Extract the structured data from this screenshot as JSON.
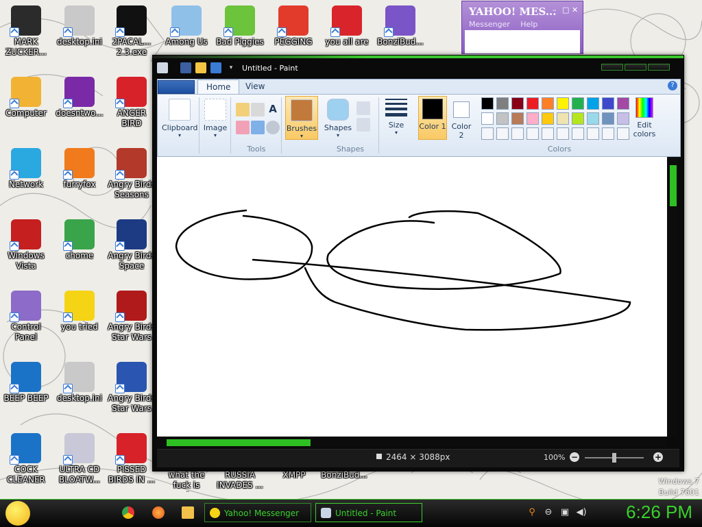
{
  "desktop_icons": [
    {
      "label": "MARK ZUCKER...",
      "color": "#2b2b2b",
      "icon": "person-icon"
    },
    {
      "label": "desktop.ini",
      "color": "#c9c9c9",
      "icon": "file-icon"
    },
    {
      "label": "2PACAL... 2.3.exe",
      "color": "#111111",
      "icon": "terminal-icon"
    },
    {
      "label": "Among Us",
      "color": "#8fc0e8",
      "icon": "among-us-icon"
    },
    {
      "label": "Bad Piggies",
      "color": "#6cc33c",
      "icon": "pig-icon"
    },
    {
      "label": "PEGGING",
      "color": "#e23b2b",
      "icon": "p-logo-icon"
    },
    {
      "label": "you all are",
      "color": "#d9242b",
      "icon": "dev-cpp-icon"
    },
    {
      "label": "BonziBud...",
      "color": "#7a55c7",
      "icon": "gorilla-icon"
    },
    {
      "label": "Computer",
      "color": "#f2b233",
      "icon": "computer-icon"
    },
    {
      "label": "doesntwo...",
      "color": "#7a2aa6",
      "icon": "yahoo-icon"
    },
    {
      "label": "ANGER BIRD",
      "color": "#d7222a",
      "icon": "angry-bird-icon"
    },
    {
      "label": "Network",
      "color": "#2aa8e0",
      "icon": "network-icon"
    },
    {
      "label": "furryfox",
      "color": "#f07a1c",
      "icon": "firefox-icon"
    },
    {
      "label": "Angry Birds Seasons",
      "color": "#b3392a",
      "icon": "angry-birds-seasons-icon"
    },
    {
      "label": "Windows Vista",
      "color": "#c51f1f",
      "icon": "recycle-bin-icon"
    },
    {
      "label": "chome",
      "color": "#3aa44a",
      "icon": "chrome-icon"
    },
    {
      "label": "Angry Birds Space",
      "color": "#1d3b83",
      "icon": "angry-birds-space-icon"
    },
    {
      "label": "Control Panel",
      "color": "#8c6bc9",
      "icon": "control-panel-icon"
    },
    {
      "label": "you tried",
      "color": "#f5d315",
      "icon": "star-icon"
    },
    {
      "label": "Angry Birds Star Wars",
      "color": "#b01a1a",
      "icon": "angry-birds-star-wars-icon"
    },
    {
      "label": "BEEP BEEP",
      "color": "#1b73c7",
      "icon": "blue-panel-icon"
    },
    {
      "label": "desktop.ini",
      "color": "#c9c9c9",
      "icon": "file-icon"
    },
    {
      "label": "Angry Birds Star Wars",
      "color": "#2a55b0",
      "icon": "angry-birds-star-wars-2-icon"
    },
    {
      "label": "COCK CLEANER",
      "color": "#1b73c7",
      "icon": "blue-panel-icon"
    },
    {
      "label": "ULTRA CD BLOATW...",
      "color": "#c8c8d8",
      "icon": "cd-icon"
    },
    {
      "label": "PISSED BIRDS IN ...",
      "color": "#d7222a",
      "icon": "angry-bird-icon"
    }
  ],
  "under_window_labels": [
    "what the fuck is goi...",
    "RUSSIA INVADES ...",
    "XMPP",
    "BonziBud..."
  ],
  "yahoo_window": {
    "title": "YAHOO! MES...",
    "menu": [
      "Messenger",
      "Help"
    ]
  },
  "paint": {
    "title": "Untitled - Paint",
    "tabs": [
      "Home",
      "View"
    ],
    "groups": {
      "clipboard": "Clipboard",
      "image": "Image",
      "tools": "Tools",
      "brushes": "Brushes",
      "shapes_btn": "Shapes",
      "shapes_group": "Shapes",
      "size": "Size",
      "color1": "Color 1",
      "color2": "Color 2",
      "colors": "Colors",
      "edit_colors": "Edit colors"
    },
    "palette_row1": [
      "#000000",
      "#7f7f7f",
      "#880015",
      "#ed1c24",
      "#ff7f27",
      "#fff200",
      "#22b14c",
      "#00a2e8",
      "#3f48cc",
      "#a349a4"
    ],
    "palette_row2": [
      "#ffffff",
      "#c3c3c3",
      "#b97a57",
      "#ffaec9",
      "#ffc90e",
      "#efe4b0",
      "#b5e61d",
      "#99d9ea",
      "#7092be",
      "#c8bfe7"
    ],
    "status": {
      "dimensions": "2464 × 3088px",
      "zoom": "100%"
    }
  },
  "taskbar": {
    "tasks": [
      {
        "label": "Yahoo! Messenger"
      },
      {
        "label": "Untitled - Paint"
      }
    ],
    "clock": "6:26 PM",
    "system_text": [
      "Windows 7",
      "Build 7601"
    ]
  },
  "colors": {
    "accent_green": "#39d12c",
    "ribbon_bg": "#dfe9f5"
  }
}
